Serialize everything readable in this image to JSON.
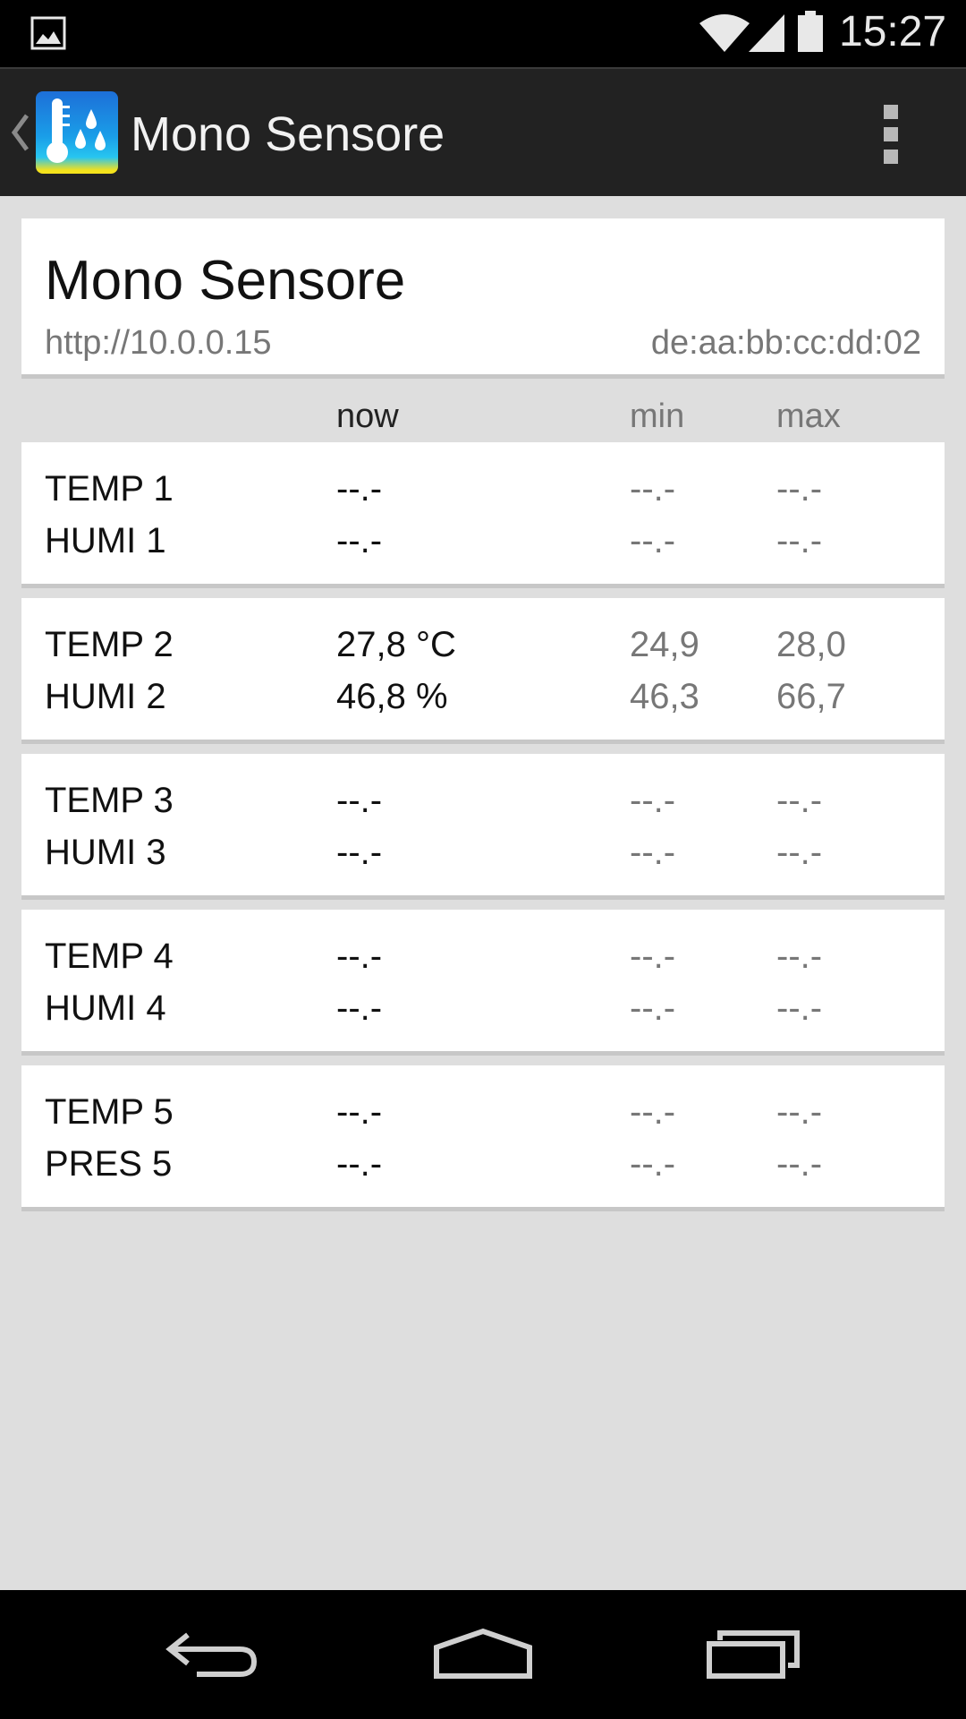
{
  "status_bar": {
    "time": "15:27",
    "icons": [
      "gallery-icon",
      "wifi-icon",
      "signal-icon",
      "battery-icon"
    ]
  },
  "action_bar": {
    "title": "Mono Sensore",
    "icons": [
      "up-chevron-icon",
      "app-thermometer-icon",
      "overflow-menu-icon"
    ]
  },
  "device": {
    "name": "Mono Sensore",
    "url": "http://10.0.0.15",
    "mac": "de:aa:bb:cc:dd:02"
  },
  "columns": {
    "now": "now",
    "min": "min",
    "max": "max"
  },
  "sensors": [
    {
      "rows": [
        {
          "label": "TEMP 1",
          "now": "--.-",
          "min": "--.-",
          "max": "--.-"
        },
        {
          "label": "HUMI 1",
          "now": "--.-",
          "min": "--.-",
          "max": "--.-"
        }
      ]
    },
    {
      "rows": [
        {
          "label": "TEMP 2",
          "now": "27,8 °C",
          "min": "24,9",
          "max": "28,0"
        },
        {
          "label": "HUMI 2",
          "now": "46,8 %",
          "min": "46,3",
          "max": "66,7"
        }
      ]
    },
    {
      "rows": [
        {
          "label": "TEMP 3",
          "now": "--.-",
          "min": "--.-",
          "max": "--.-"
        },
        {
          "label": "HUMI 3",
          "now": "--.-",
          "min": "--.-",
          "max": "--.-"
        }
      ]
    },
    {
      "rows": [
        {
          "label": "TEMP 4",
          "now": "--.-",
          "min": "--.-",
          "max": "--.-"
        },
        {
          "label": "HUMI 4",
          "now": "--.-",
          "min": "--.-",
          "max": "--.-"
        }
      ]
    },
    {
      "rows": [
        {
          "label": "TEMP 5",
          "now": "--.-",
          "min": "--.-",
          "max": "--.-"
        },
        {
          "label": "PRES 5",
          "now": "--.-",
          "min": "--.-",
          "max": "--.-"
        }
      ]
    }
  ],
  "nav_bar": {
    "icons": [
      "back-icon",
      "home-icon",
      "recents-icon"
    ]
  },
  "colors": {
    "background": "#dedede",
    "action_bar": "#222222",
    "card": "#ffffff",
    "secondary_text": "#777777"
  }
}
